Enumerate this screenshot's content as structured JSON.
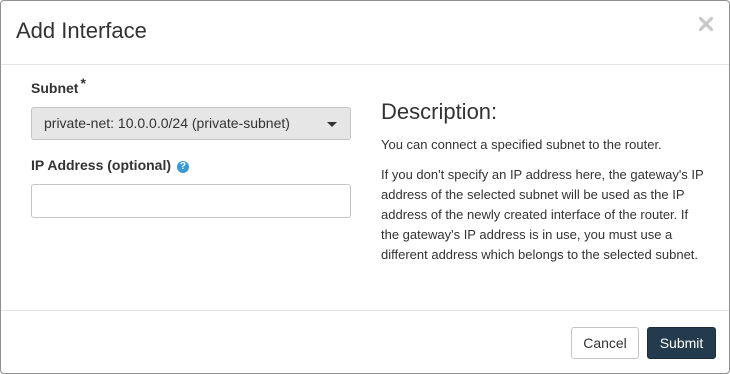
{
  "dialog": {
    "title": "Add Interface",
    "close_symbol": "×"
  },
  "form": {
    "subnet_label": "Subnet",
    "required_marker": "*",
    "subnet_selected": "private-net: 10.0.0.0/24 (private-subnet)",
    "ip_label": "IP Address (optional)",
    "help_symbol": "?",
    "ip_value": "",
    "ip_placeholder": ""
  },
  "description": {
    "title": "Description:",
    "paragraphs": [
      "You can connect a specified subnet to the router.",
      "If you don't specify an IP address here, the gateway's IP address of the selected subnet will be used as the IP address of the newly created interface of the router. If the gateway's IP address is in use, you must use a different address which belongs to the selected subnet."
    ]
  },
  "footer": {
    "cancel_label": "Cancel",
    "submit_label": "Submit"
  },
  "icons": {
    "close": "close-icon",
    "help": "help-icon",
    "dropdown": "chevron-down-icon"
  },
  "colors": {
    "submit_bg": "#243b4e",
    "help_icon": "#3a9bd5",
    "select_bg": "#e6e6e6"
  }
}
